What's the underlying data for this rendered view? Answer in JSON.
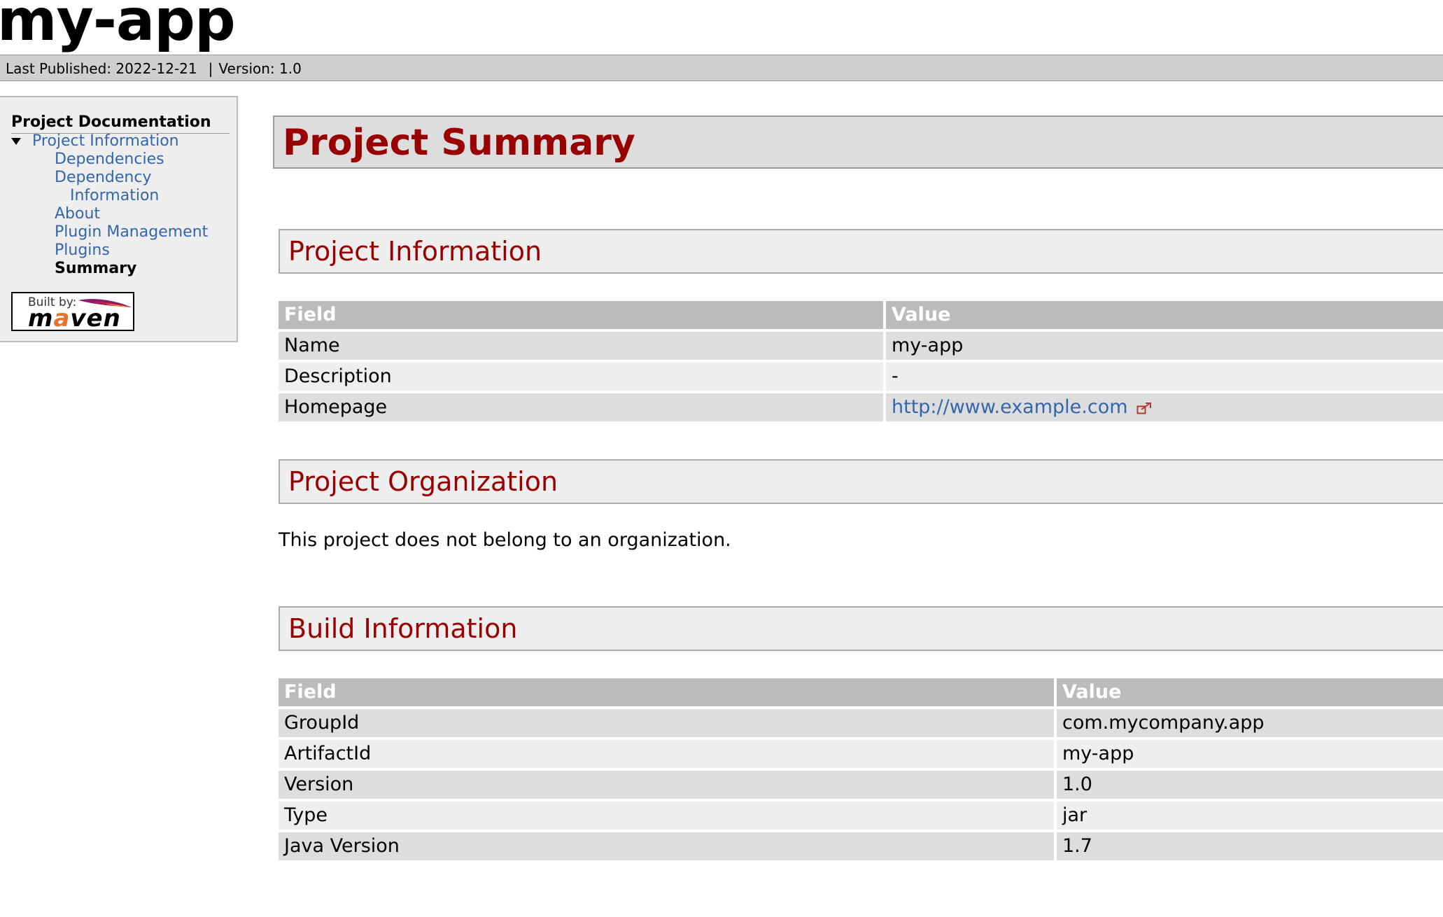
{
  "banner": {
    "title": "my-app"
  },
  "breadcrumbs": {
    "published": "Last Published: 2022-12-21",
    "separator": "|",
    "version": "Version: 1.0"
  },
  "sidebar": {
    "heading": "Project Documentation",
    "items": [
      {
        "label": "Project Information"
      },
      {
        "label": "Dependencies"
      },
      {
        "label": "Dependency"
      },
      {
        "label": "Information"
      },
      {
        "label": "About"
      },
      {
        "label": "Plugin Management"
      },
      {
        "label": "Plugins"
      },
      {
        "label": "Summary"
      }
    ],
    "powered_by": {
      "built_by": "Built by:",
      "word_start": "m",
      "word_accent": "a",
      "word_end": "ven"
    }
  },
  "main": {
    "title": "Project Summary",
    "project_information": {
      "heading": "Project Information",
      "columns": [
        "Field",
        "Value"
      ],
      "rows": [
        {
          "field": "Name",
          "value": "my-app"
        },
        {
          "field": "Description",
          "value": "-"
        },
        {
          "field": "Homepage",
          "value": "http://www.example.com"
        }
      ]
    },
    "project_organization": {
      "heading": "Project Organization",
      "text": "This project does not belong to an organization."
    },
    "build_information": {
      "heading": "Build Information",
      "columns": [
        "Field",
        "Value"
      ],
      "rows": [
        {
          "field": "GroupId",
          "value": "com.mycompany.app"
        },
        {
          "field": "ArtifactId",
          "value": "my-app"
        },
        {
          "field": "Version",
          "value": "1.0"
        },
        {
          "field": "Type",
          "value": "jar"
        },
        {
          "field": "Java Version",
          "value": "1.7"
        }
      ]
    }
  },
  "colors": {
    "heading_red": "#990000",
    "link_blue": "#3366aa",
    "breadcrumb_bg": "#cfcfcf",
    "sidebar_bg": "#eeeeee"
  }
}
